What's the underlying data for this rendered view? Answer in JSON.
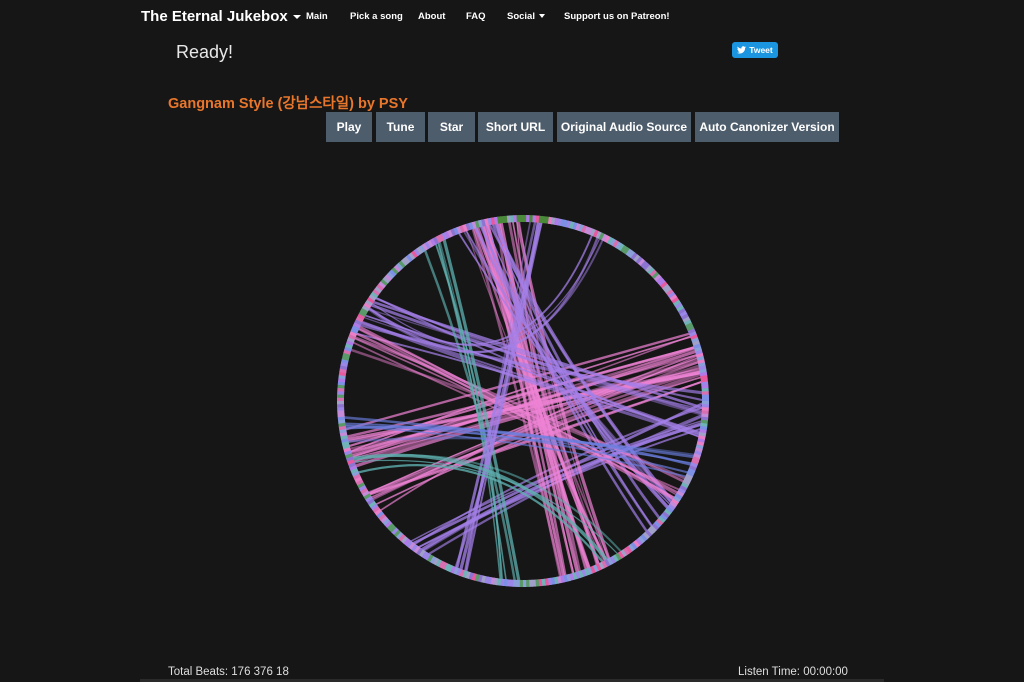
{
  "navbar": {
    "brand": "The Eternal Jukebox",
    "items": [
      {
        "label": "Main"
      },
      {
        "label": "Pick a song"
      },
      {
        "label": "About"
      },
      {
        "label": "FAQ"
      },
      {
        "label": "Social"
      },
      {
        "label": "Support us on Patreon!"
      }
    ]
  },
  "status_text": "Ready!",
  "tweet_label": "Tweet",
  "song_title": "Gangnam Style (강남스타일) by PSY",
  "buttons": [
    {
      "label": "Play"
    },
    {
      "label": "Tune"
    },
    {
      "label": "Star"
    },
    {
      "label": "Short URL"
    },
    {
      "label": "Original Audio Source"
    },
    {
      "label": "Auto Canonizer Version"
    }
  ],
  "footer": {
    "total_beats": "Total Beats: 176 376 18",
    "listen_time": "Listen Time: 00:00:00"
  },
  "playback_progress": 0,
  "colors": {
    "background": "#161616",
    "title": "#e8762b",
    "button": "#4e5d6c",
    "tweet": "#1b95e0",
    "arc_pink": "#ee82d4",
    "arc_violet": "#a37fe8",
    "arc_teal": "#5fb0b0",
    "arc_blue": "#6a7fe0"
  },
  "icons": {
    "brand_menu": "caret-down-icon",
    "social_menu": "caret-down-icon",
    "tweet": "twitter-bird-icon"
  }
}
